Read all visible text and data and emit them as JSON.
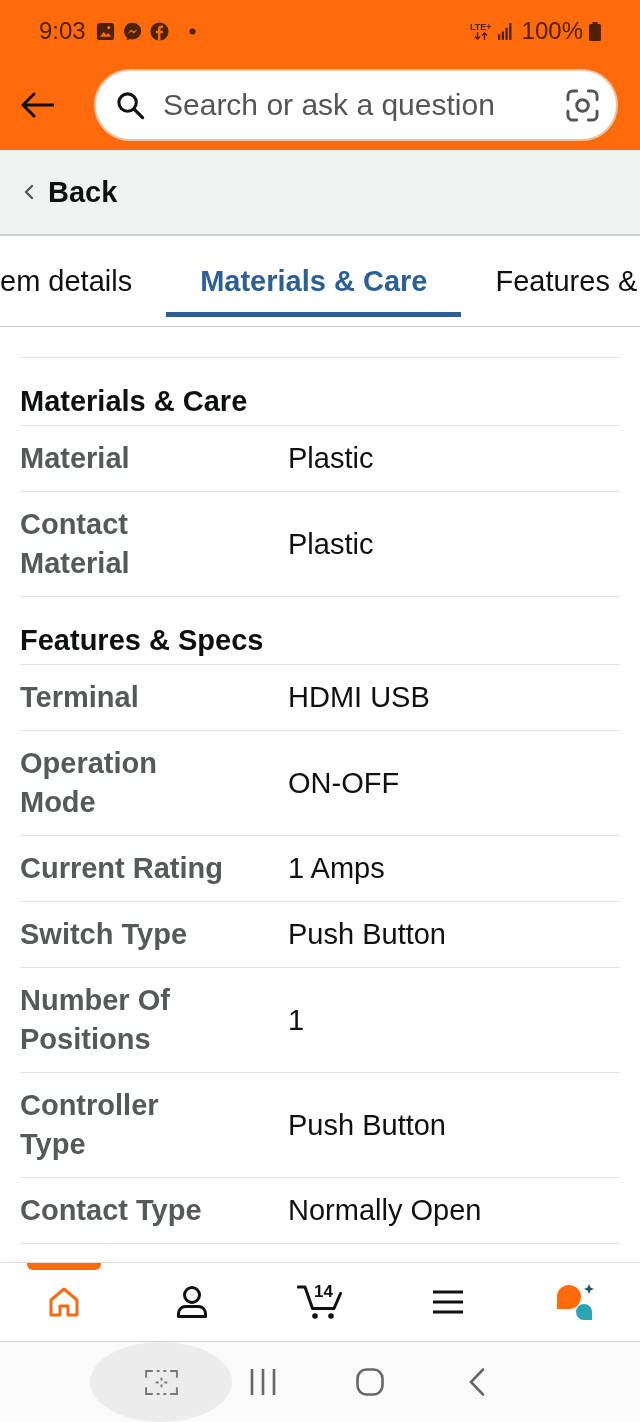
{
  "status_bar": {
    "time": "9:03",
    "network": "LTE+",
    "battery": "100%"
  },
  "search": {
    "placeholder": "Search or ask a question"
  },
  "back": {
    "label": "Back"
  },
  "tabs": [
    {
      "label": "em details",
      "selected": false
    },
    {
      "label": "Materials & Care",
      "selected": true
    },
    {
      "label": "Features &",
      "selected": false
    }
  ],
  "sections": [
    {
      "title": "Materials & Care",
      "rows": [
        {
          "label": "Material",
          "value": "Plastic"
        },
        {
          "label": "Contact Material",
          "value": "Plastic"
        }
      ]
    },
    {
      "title": "Features & Specs",
      "rows": [
        {
          "label": "Terminal",
          "value": "HDMI USB"
        },
        {
          "label": "Operation Mode",
          "value": "ON-OFF"
        },
        {
          "label": "Current Rating",
          "value": "1 Amps"
        },
        {
          "label": "Switch Type",
          "value": "Push Button"
        },
        {
          "label": "Number Of Positions",
          "value": "1"
        },
        {
          "label": "Controller Type",
          "value": "Push Button"
        },
        {
          "label": "Contact Type",
          "value": "Normally Open"
        }
      ]
    }
  ],
  "bottom_nav": [
    {
      "kind": "home",
      "selected": true
    },
    {
      "kind": "account",
      "selected": false
    },
    {
      "kind": "cart",
      "selected": false,
      "badge": "14"
    },
    {
      "kind": "menu",
      "selected": false
    },
    {
      "kind": "assistant",
      "selected": false
    }
  ]
}
